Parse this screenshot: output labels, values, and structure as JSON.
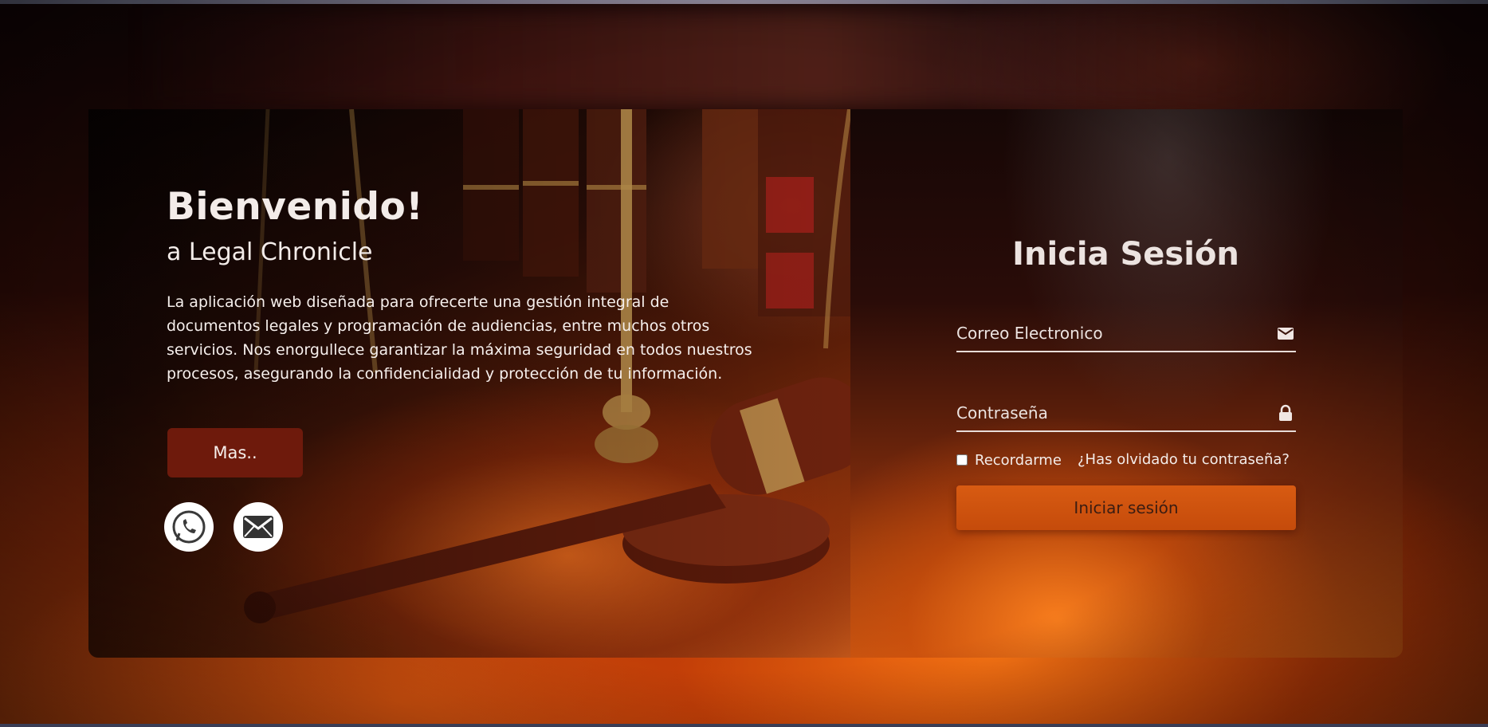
{
  "hero": {
    "title": "Bienvenido!",
    "subtitle": "a Legal Chronicle",
    "description": "La aplicación web diseñada para ofrecerte una gestión integral de documentos legales y programación de audiencias, entre muchos otros servicios. Nos enorgullece garantizar la máxima seguridad en todos nuestros procesos, asegurando la confidencialidad y protección de tu información.",
    "more_button": "Mas..",
    "social": [
      {
        "icon": "whatsapp-icon"
      },
      {
        "icon": "mail-icon"
      }
    ]
  },
  "login": {
    "title": "Inicia Sesión",
    "email_placeholder": "Correo Electronico",
    "password_placeholder": "Contraseña",
    "remember_label": "Recordarme",
    "forgot_link": "¿Has olvidado tu contraseña?",
    "submit_label": "Iniciar sesión"
  },
  "colors": {
    "accent": "#6e1a0c",
    "submit": "#d05210",
    "text": "#f3ece9"
  }
}
